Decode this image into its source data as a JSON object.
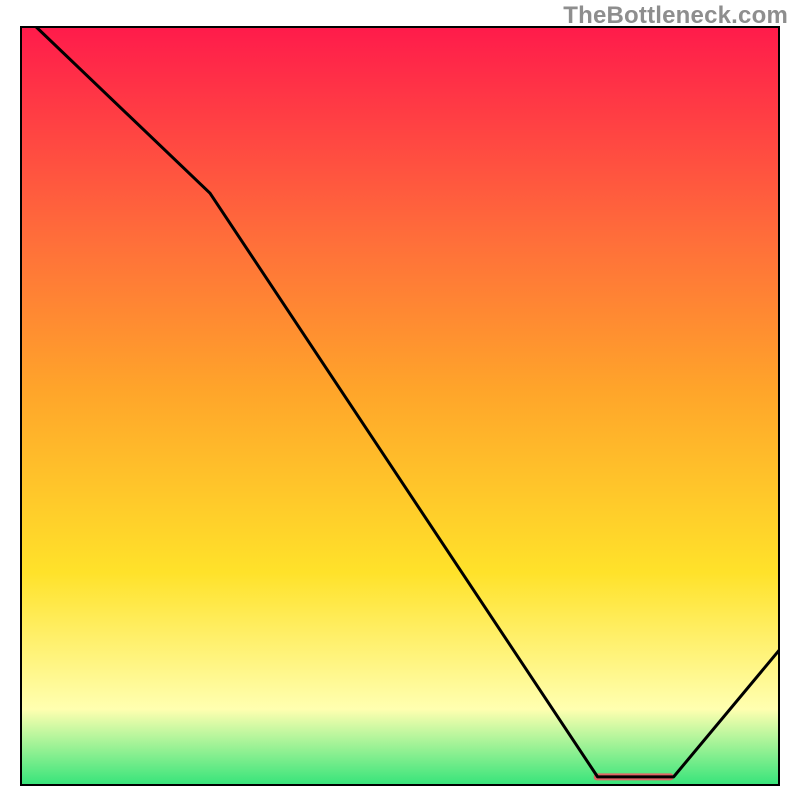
{
  "watermark": "TheBottleneck.com",
  "colors": {
    "gradient_top": "#ff1b4b",
    "gradient_mid_red_orange": "#ff6e3a",
    "gradient_mid_orange": "#ffa52a",
    "gradient_mid_yellow": "#ffe22a",
    "gradient_light_yellow": "#ffffb0",
    "gradient_bottom": "#36e47a",
    "line_color": "#000000",
    "marker_fill": "#e06666",
    "border": "#000000"
  },
  "chart_data": {
    "type": "line",
    "title": "",
    "xlabel": "",
    "ylabel": "",
    "xlim": [
      0,
      100
    ],
    "ylim": [
      0,
      100
    ],
    "x": [
      2,
      25,
      76,
      86,
      100
    ],
    "values": [
      100,
      78,
      1.2,
      1.2,
      18
    ],
    "marker": {
      "x_start": 75.5,
      "x_end": 86,
      "y": 1.2
    },
    "background": "vertical_gradient_red_to_green"
  }
}
